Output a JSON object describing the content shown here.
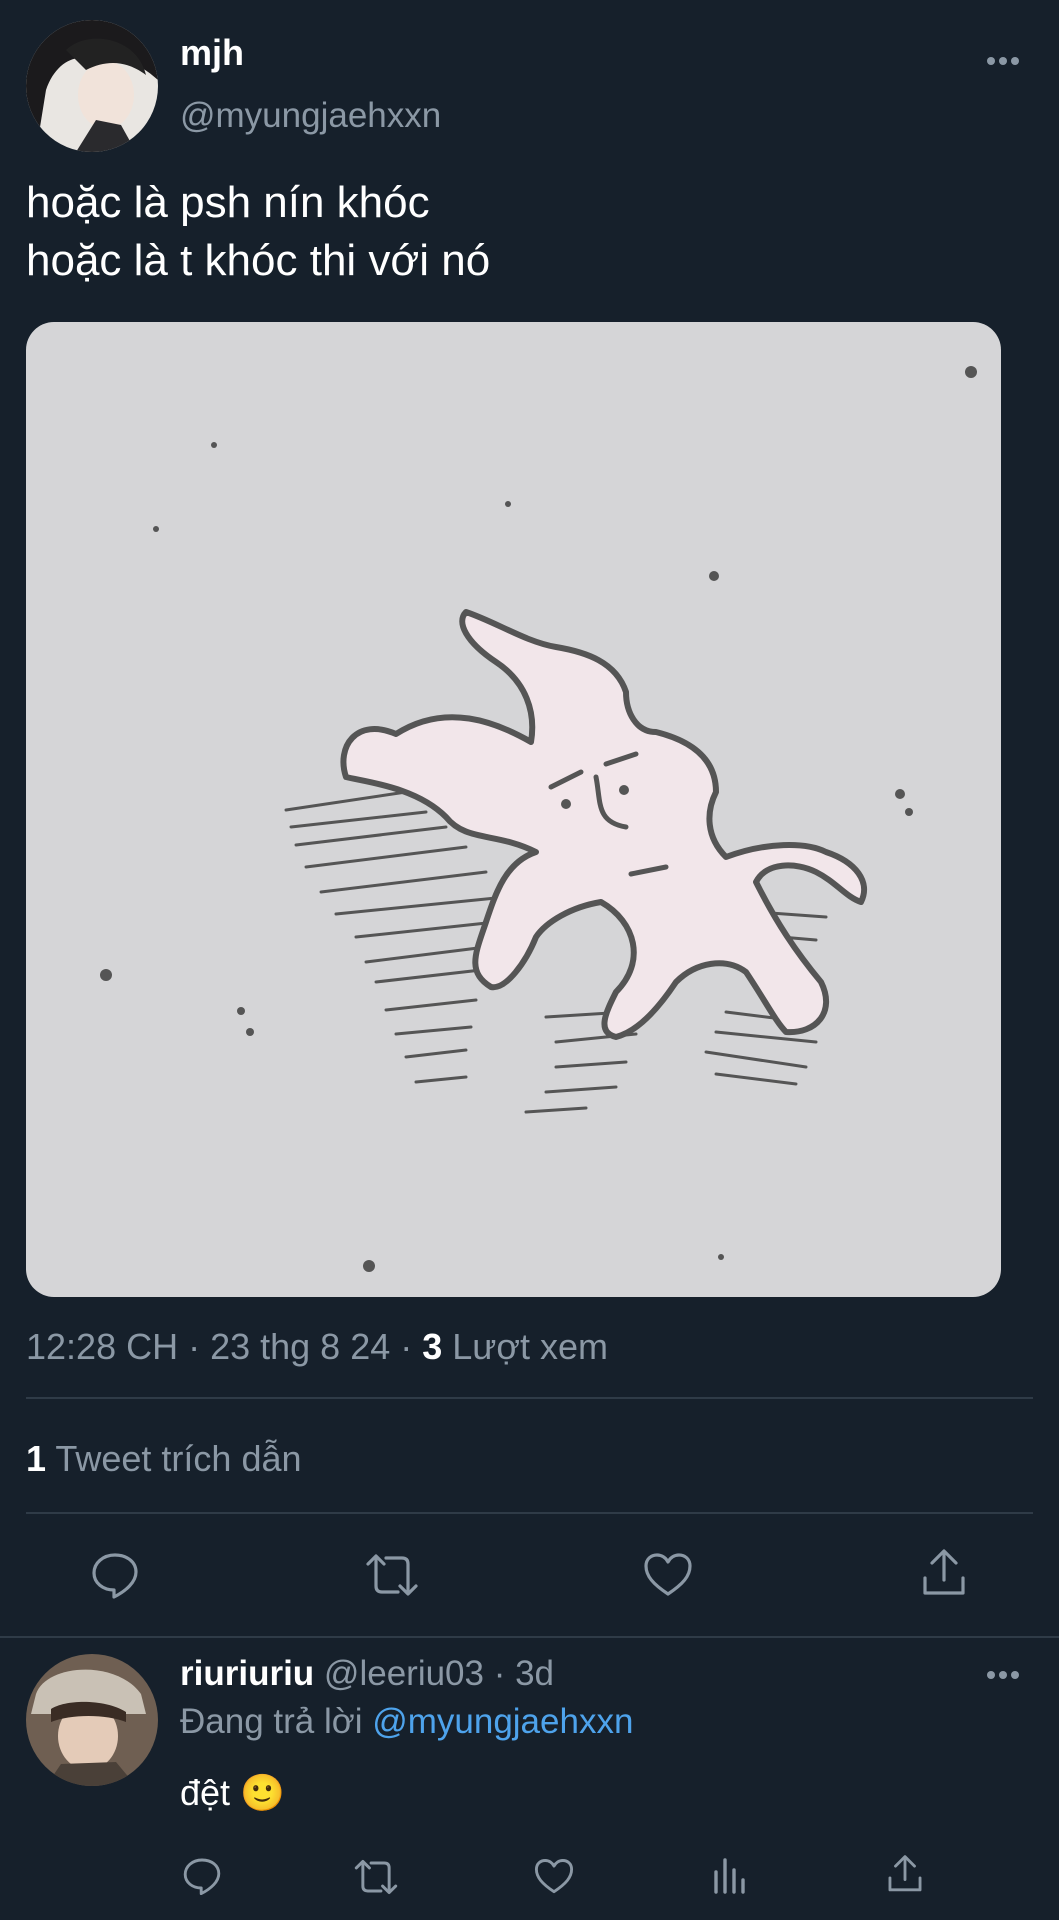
{
  "main_tweet": {
    "author_name": "mjh",
    "author_handle": "@myungjaehxxn",
    "text_line1": "hoặc là psh nín khóc",
    "text_line2": "hoặc là t khóc thi với nó",
    "time": "12:28 CH · 23 thg 8 24 · ",
    "views_count": "3",
    "views_label": " Lượt xem",
    "quotes_count": "1",
    "quotes_label": " Tweet trích dẫn"
  },
  "reply": {
    "author_name": "riuriuriu",
    "author_meta": "@leeriu03 · 3d",
    "replying_prefix": "Đang trả lời ",
    "replying_to": "@myungjaehxxn",
    "text": "đệt 🙂"
  },
  "icons": {
    "more": "more-icon",
    "reply": "reply-icon",
    "retweet": "retweet-icon",
    "like": "like-icon",
    "share": "share-icon",
    "analytics": "analytics-icon"
  },
  "colors": {
    "background": "#16202b",
    "secondary_text": "#8b98a5",
    "link": "#4ea3ec",
    "divider": "#2f3b47"
  }
}
